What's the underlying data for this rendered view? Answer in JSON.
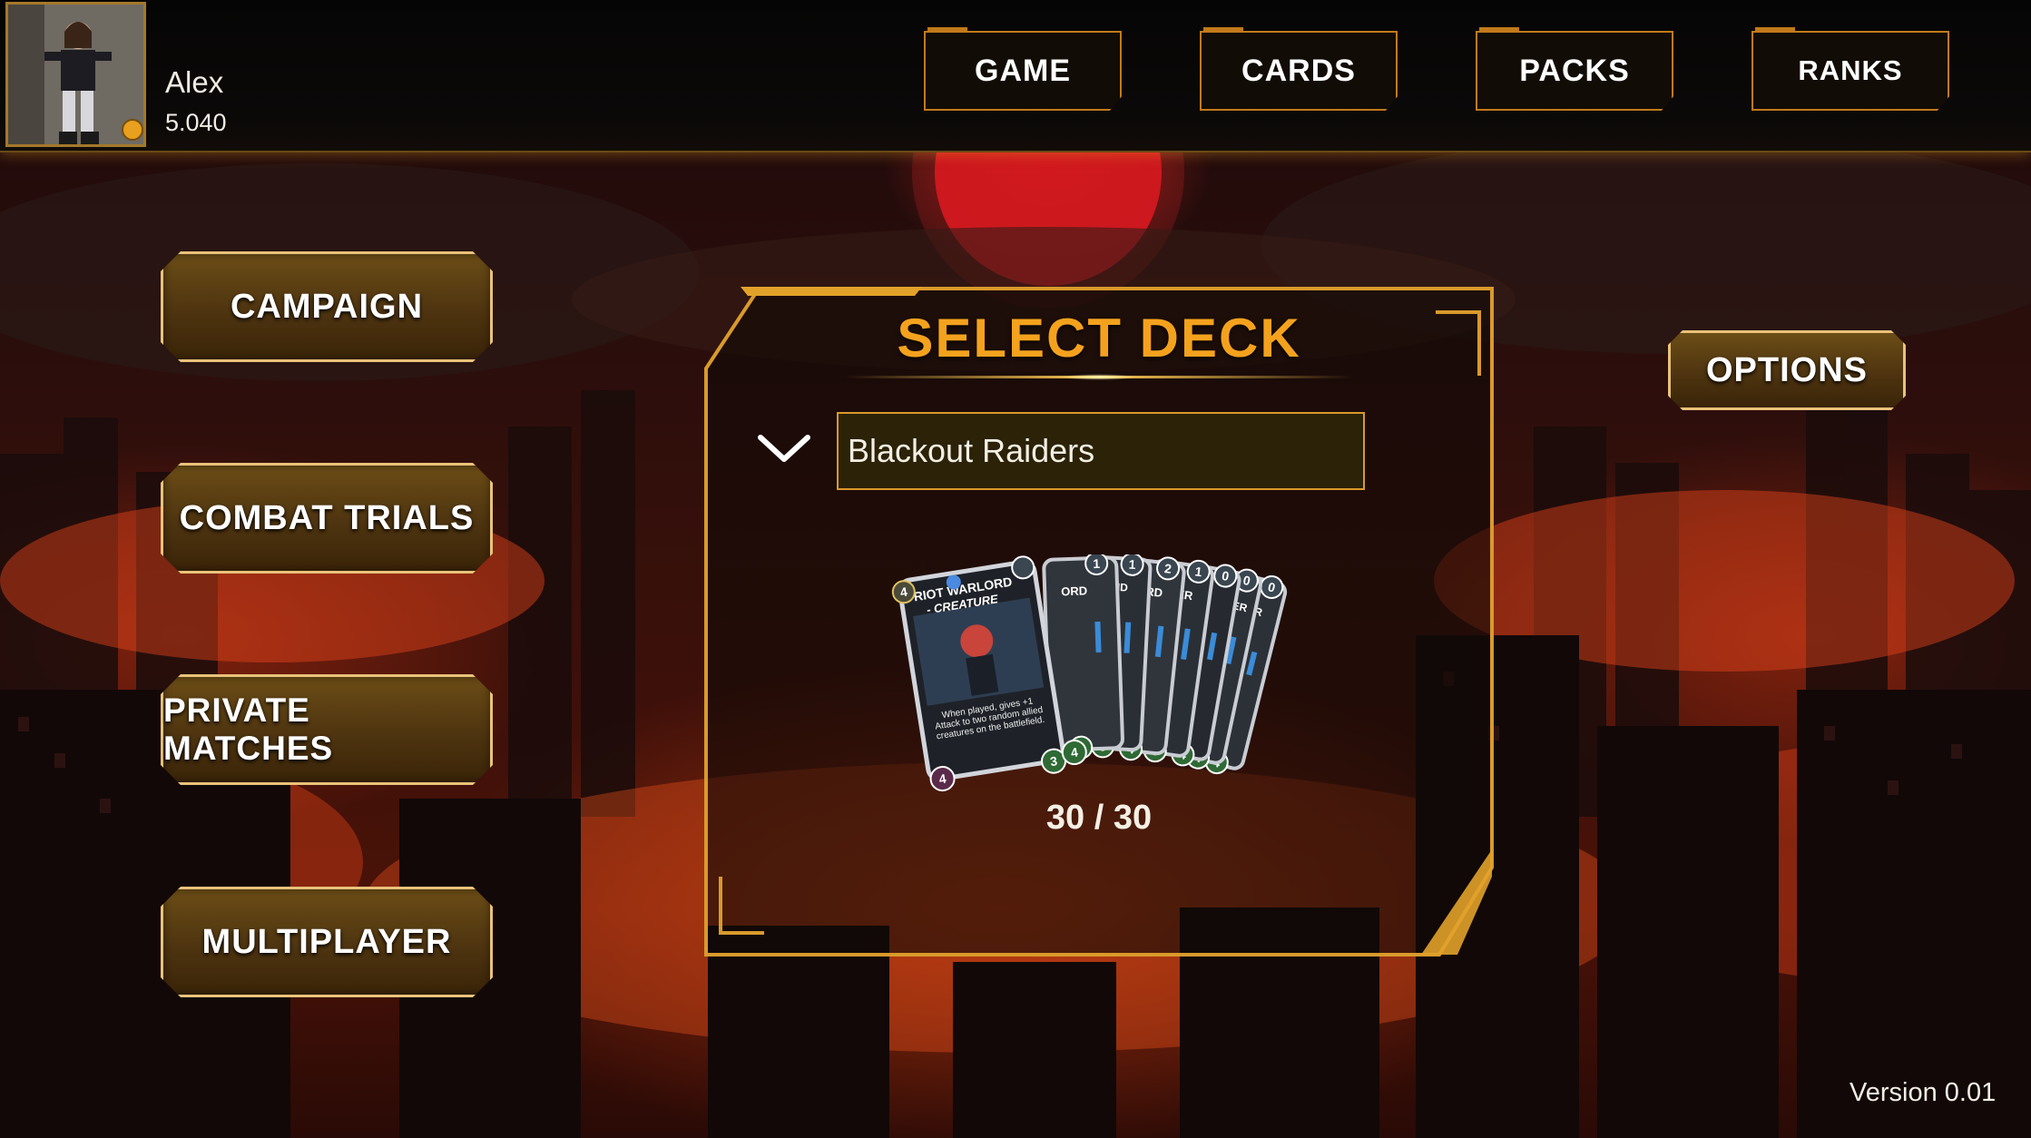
{
  "player": {
    "name": "Alex",
    "currency": "5.040"
  },
  "nav": [
    {
      "label": "GAME"
    },
    {
      "label": "CARDS"
    },
    {
      "label": "PACKS"
    },
    {
      "label": "RANKS"
    }
  ],
  "menu": [
    {
      "label": "CAMPAIGN"
    },
    {
      "label": "COMBAT TRIALS"
    },
    {
      "label": "PRIVATE MATCHES"
    },
    {
      "label": "MULTIPLAYER"
    }
  ],
  "options_label": "OPTIONS",
  "deck": {
    "title": "SELECT DECK",
    "selected": "Blackout Raiders",
    "count": "30 / 30",
    "front_card": {
      "name": "RIOT WARLORD",
      "type": "- CREATURE",
      "text": "When played, gives +1 Attack to two random allied creatures on the battlefield.",
      "cost": "4",
      "attack": "3",
      "health": "4",
      "level": "4"
    },
    "fan_cards": [
      {
        "title": "ORD",
        "cost": "1",
        "stat": "3"
      },
      {
        "title": "HAND",
        "cost": "1",
        "stat": "3"
      },
      {
        "title": "ORD",
        "cost": "2",
        "stat": "4"
      },
      {
        "title": "KER",
        "cost": "1",
        "stat": "3"
      },
      {
        "title": "",
        "cost": "0",
        "stat": "4"
      },
      {
        "title": "ER",
        "cost": "0",
        "stat": "4"
      },
      {
        "title": "R",
        "cost": "0",
        "stat": "4"
      }
    ]
  },
  "version": "Version 0.01",
  "colors": {
    "accent_gold": "#f4a21d",
    "button_border": "#e9c27a",
    "panel_border": "#d99a2b",
    "nav_border": "#c27a1a"
  }
}
